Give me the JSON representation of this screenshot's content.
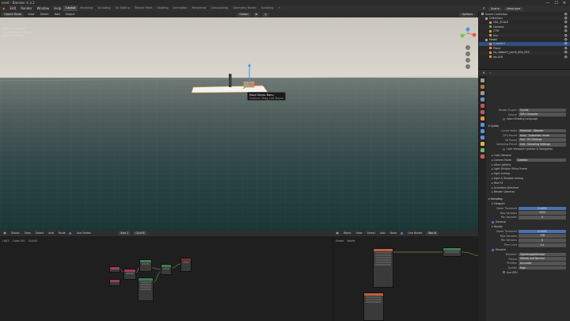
{
  "window": {
    "title": "ered - Blender 4.3.2",
    "controls": [
      "—",
      "☐",
      "✕"
    ]
  },
  "top_menu": [
    "Edit",
    "Render",
    "Window",
    "Help"
  ],
  "workspaces": [
    "Layout",
    "Modeling",
    "Sculpting",
    "UV Editing",
    "Texture Paint",
    "Shading",
    "Animation",
    "Rendering",
    "Compositing",
    "Geometry Nodes",
    "Scripting",
    "+"
  ],
  "scene_selector": "Scene",
  "view_layer": "ViewLayer",
  "viewport_header": {
    "mode": "Object Mode",
    "menus": [
      "View",
      "Select",
      "Add",
      "Object"
    ],
    "orientation": "Default",
    "drag": "Select Box",
    "transform": "Global",
    "options": "Options"
  },
  "viewport": {
    "overlay_lines": [
      "User Perspective",
      "(1) Collection | ES1B",
      "Scene Statistics"
    ],
    "tooltip_title": "Move Gizmo: Menu",
    "tooltip_hint": "Shortcut: Drag, Left Mouse"
  },
  "shader_editor_left": {
    "menus": [
      "Object",
      "View",
      "Select",
      "Add",
      "Node",
      "Use Nodes"
    ],
    "slot": "Slot 1",
    "material": "GLASS",
    "breadcrumb": [
      "LA03",
      "Cube.001",
      "GLASS"
    ]
  },
  "shader_editor_right": {
    "menus": [
      "World",
      "View",
      "Select",
      "Add",
      "Node",
      "Use Nodes"
    ],
    "world": "World",
    "breadcrumb": [
      "Scene",
      "World"
    ]
  },
  "outliner": {
    "title": "Scene Collection",
    "items": [
      {
        "label": "Scene Collection",
        "indent": 0,
        "color": "#9c9c9c",
        "selected": false
      },
      {
        "label": "Collection",
        "indent": 1,
        "color": "#9c9c9c",
        "selected": false
      },
      {
        "label": "CBL_SCALE",
        "indent": 2,
        "color": "#e0914a",
        "selected": false
      },
      {
        "label": "Camera",
        "indent": 2,
        "color": "#6fa36f",
        "selected": false
      },
      {
        "label": "CTM",
        "indent": 2,
        "color": "#e0914a",
        "selected": false
      },
      {
        "label": "Sun",
        "indent": 2,
        "color": "#e0914a",
        "selected": false
      },
      {
        "label": "Model",
        "indent": 1,
        "color": "#9c9c9c",
        "selected": false
      },
      {
        "label": "Cube001",
        "indent": 2,
        "color": "#e0914a",
        "selected": true
      },
      {
        "label": "Plane",
        "indent": 2,
        "color": "#e0914a",
        "selected": false
      },
      {
        "label": "vs_ribbon0_yamil_004_ESS",
        "indent": 2,
        "color": "#e0914a",
        "selected": false
      },
      {
        "label": "ws.016",
        "indent": 2,
        "color": "#e0914a",
        "selected": false
      }
    ]
  },
  "properties": {
    "render_engine_label": "Render Engine",
    "render_engine": "Cycles",
    "device_label": "Device",
    "device": "GPU Compute",
    "open_shading_language": "Open Shading Language",
    "gpu_panel": "Cycles",
    "rows": [
      {
        "k": "Cycles Mode",
        "v": "Premium - Blender"
      },
      {
        "k": "GPU Bound",
        "v": "Auto - Automatic mode"
      },
      {
        "k": "3D Preset",
        "v": "Inst - RX Settings"
      },
      {
        "k": "Sampling Preset",
        "v": "Inst - Sampling Settings"
      }
    ],
    "lock_viewport": "Lock Viewport Updates & Navigation",
    "sections": [
      "Color Denoise",
      "Camera Mode",
      "Ultra Lighting",
      "Light Division Micro Frame",
      "Light Linking",
      "Light & Shadow Linking",
      "Post FX",
      "Animation Denoiser",
      "Render Cameras"
    ],
    "camera_mode_value": "Camera",
    "sampling": "Sampling",
    "viewport": "Viewport",
    "viewport_rows": [
      {
        "k": "Noise Threshold",
        "v": "0.1000"
      },
      {
        "k": "Max Samples",
        "v": "1024"
      },
      {
        "k": "Min Samples",
        "v": "0"
      }
    ],
    "denoise": "Denoise",
    "render": "Render",
    "render_rows": [
      {
        "k": "Noise Threshold",
        "v": "0.0100"
      },
      {
        "k": "Max Samples",
        "v": "128"
      },
      {
        "k": "Min Samples",
        "v": "0"
      },
      {
        "k": "Time Limit",
        "v": "0 s"
      }
    ],
    "denoise2": "Denoise",
    "denoise_rows": [
      {
        "k": "Denoiser",
        "v": "OpenImageDenoise"
      },
      {
        "k": "Passes",
        "v": "Albedo and Normal"
      },
      {
        "k": "Prefilter",
        "v": "Accurate"
      },
      {
        "k": "Quality",
        "v": "High"
      }
    ],
    "use_gpu": "Use GPU"
  },
  "colors": {
    "accent": "#4772b3",
    "selection": "#334d80",
    "sky_top": "#d6d2c8",
    "ground_far": "#4a5a56",
    "ground_near": "#1d3a3c"
  }
}
